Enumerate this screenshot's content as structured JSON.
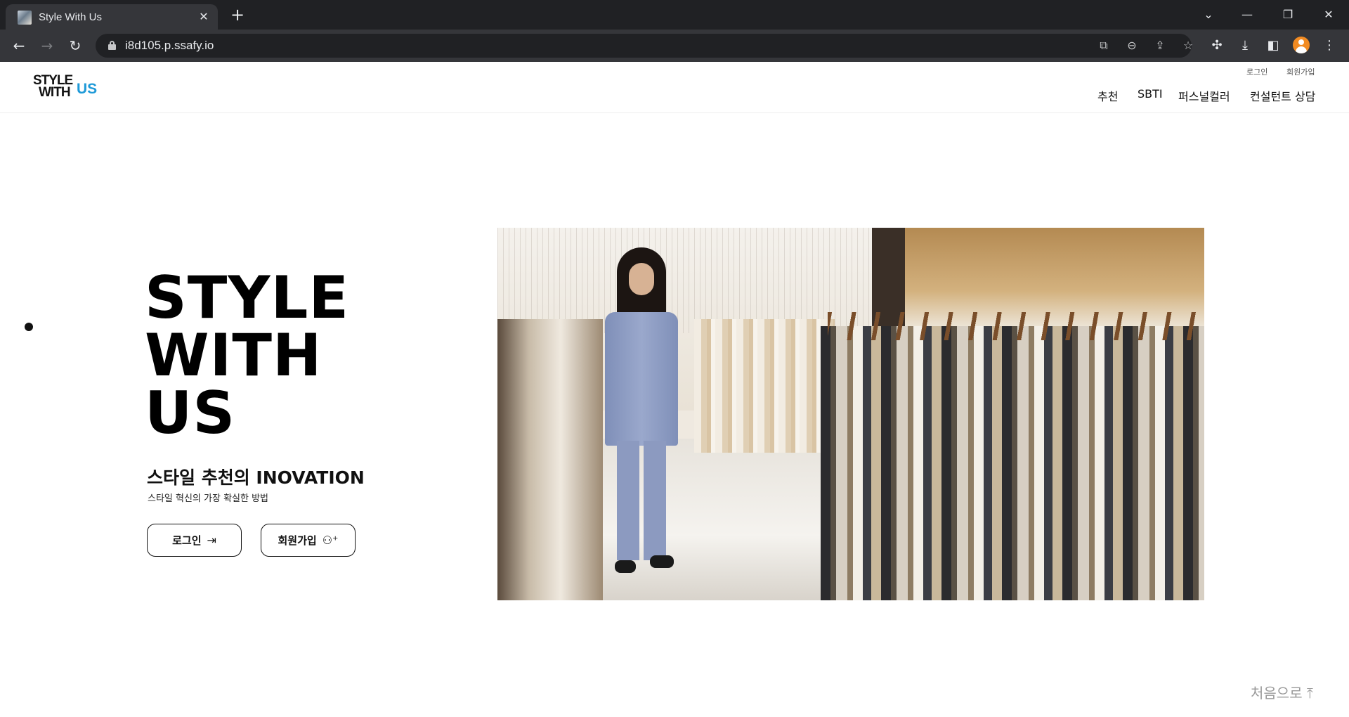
{
  "browser": {
    "tab_title": "Style With Us",
    "tab_close": "✕",
    "new_tab": "+",
    "url": "i8d105.p.ssafy.io",
    "window_controls": {
      "tab_search": "⌄",
      "minimize": "—",
      "restore": "❐",
      "close": "✕"
    },
    "nav": {
      "back": "←",
      "forward": "→",
      "reload": "↻"
    },
    "omnibox_icons": {
      "translate": "⧉",
      "zoom": "⊖",
      "share": "⇪",
      "bookmark": "☆"
    },
    "toolbar_icons": {
      "extensions": "✣",
      "downloads": "⤓",
      "side_panel": "◧",
      "menu": "⋮"
    }
  },
  "site": {
    "logo": {
      "line1": "STYLE",
      "line2": "WITH",
      "accent": "US",
      "accent_color": "#1f9ad8"
    },
    "top_links": {
      "login": "로그인",
      "signup": "회원가입"
    },
    "nav": [
      "추천",
      "SBTI",
      "퍼스널컬러",
      "컨설턴트 상담"
    ]
  },
  "hero": {
    "title_lines": [
      "STYLE",
      "WITH",
      "US"
    ],
    "subtitle": "스타일 추천의 INOVATION",
    "description": "스타일 혁신의 가장 확실한 방법",
    "login_button": "로그인",
    "login_icon": "⇥",
    "signup_button": "회원가입",
    "signup_icon": "⚇⁺"
  },
  "scroll_top": {
    "label": "처음으로",
    "icon": "⤒"
  }
}
